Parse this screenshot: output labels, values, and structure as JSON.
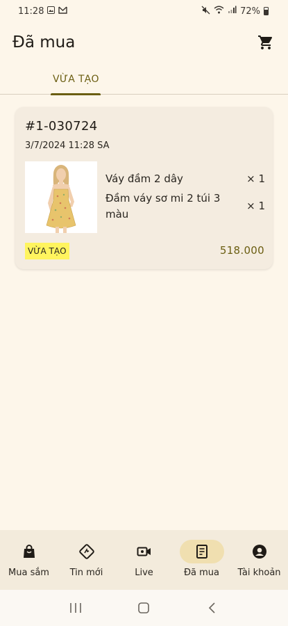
{
  "status_bar": {
    "time": "11:28",
    "battery_text": "72%"
  },
  "header": {
    "title": "Đã mua",
    "cart_icon": "cart-icon"
  },
  "tabs": [
    {
      "label": "VỪA TẠO",
      "active": true
    }
  ],
  "order": {
    "id": "#1-030724",
    "date": "3/7/2024 11:28 SA",
    "items": [
      {
        "name": "Váy đầm 2 dây",
        "qty": "× 1"
      },
      {
        "name": "Đầm váy sơ mi 2 túi 3 màu",
        "qty": "× 1"
      }
    ],
    "status": "VỪA TẠO",
    "total": "518.000",
    "status_color": "#fff45e",
    "accent_color": "#6b5e12"
  },
  "bottom_nav": [
    {
      "label": "Mua sắm",
      "icon": "shopping-bag-icon"
    },
    {
      "label": "Tin mới",
      "icon": "news-icon"
    },
    {
      "label": "Live",
      "icon": "video-icon"
    },
    {
      "label": "Đã mua",
      "icon": "receipt-icon",
      "active": true
    },
    {
      "label": "Tài khoản",
      "icon": "account-icon"
    }
  ],
  "system_nav": {
    "recents": "recents-icon",
    "home": "home-icon",
    "back": "back-icon"
  }
}
